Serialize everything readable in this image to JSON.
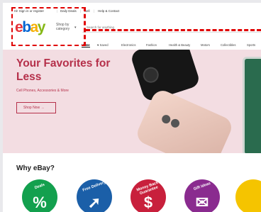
{
  "topbar": {
    "signin": "Hi! Sign in or register",
    "daily_deals": "Daily Deals",
    "sell": "Sell",
    "help": "Help & Contact"
  },
  "header": {
    "logo": {
      "e": "e",
      "b": "b",
      "a": "a",
      "y": "y"
    },
    "shop_by": "Shop by category",
    "search_placeholder": "Search for anything"
  },
  "nav": {
    "items": [
      "Home",
      "♥ Saved",
      "Electronics",
      "Fashion",
      "Health & Beauty",
      "Motors",
      "Collectibles",
      "Sports"
    ]
  },
  "hero": {
    "title": "Your Favorites for Less",
    "subtitle": "Cell Phones, Accessories & More",
    "cta": "Shop Now →"
  },
  "why": {
    "title": "Why eBay?",
    "features": [
      {
        "label": "Deals",
        "glyph": "%",
        "color": "#13a04e",
        "icon": "percent-icon"
      },
      {
        "label": "Free Delivery",
        "glyph": "➚",
        "color": "#1b5fa8",
        "icon": "rocket-icon"
      },
      {
        "label": "Money Back Guarantee",
        "glyph": "$",
        "color": "#c8203c",
        "icon": "dollar-icon"
      },
      {
        "label": "Gift Ideas",
        "glyph": "✉",
        "color": "#8a2b8f",
        "icon": "gift-icon"
      }
    ]
  }
}
